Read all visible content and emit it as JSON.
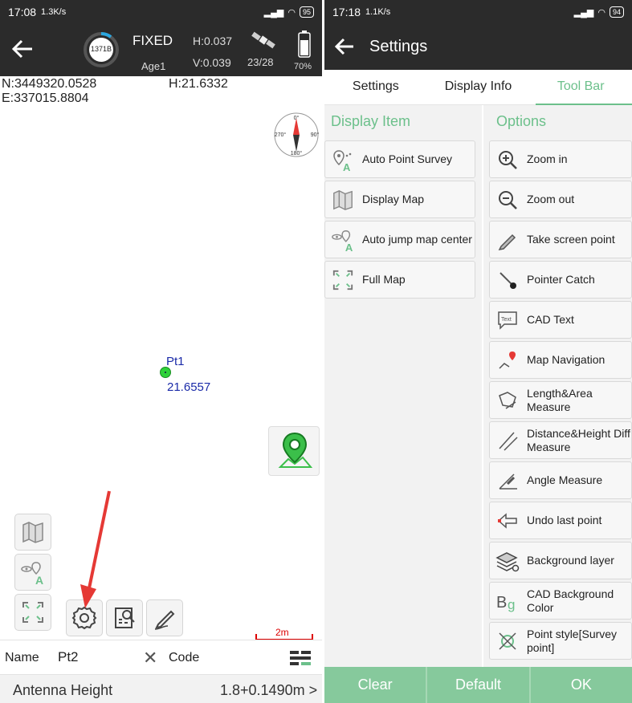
{
  "left_status": {
    "time": "17:08",
    "speed": "1.3K/s",
    "battery": "95"
  },
  "right_status": {
    "time": "17:18",
    "speed": "1.1K/s",
    "battery": "94"
  },
  "survey_header": {
    "station": "1371B",
    "solution": "FIXED",
    "age": "Age1",
    "h_precision": "H:0.037",
    "v_precision": "V:0.039",
    "satellites": "23/28",
    "battery_percent": "70%"
  },
  "coordinates": {
    "north": "N:3449320.0528",
    "height": "H:21.6332",
    "east": "E:337015.8804"
  },
  "compass": {
    "north": "0°",
    "east": "90°",
    "west": "270°",
    "south": "180°"
  },
  "map": {
    "point_name": "Pt1",
    "point_height": "21.6557",
    "scale": "2m"
  },
  "fields": {
    "name_label": "Name",
    "name_value": "Pt2",
    "code_label": "Code",
    "antenna_label": "Antenna Height",
    "antenna_value": "1.8+0.1490m >"
  },
  "settings": {
    "title": "Settings",
    "tabs": [
      {
        "label": "Settings"
      },
      {
        "label": "Display Info"
      },
      {
        "label": "Tool Bar"
      }
    ],
    "display_item_header": "Display Item",
    "options_header": "Options",
    "display_items": [
      {
        "label": "Auto Point Survey",
        "icon": "auto-point-survey-icon"
      },
      {
        "label": "Display Map",
        "icon": "map-icon"
      },
      {
        "label": "Auto jump map center",
        "icon": "auto-jump-icon"
      },
      {
        "label": "Full Map",
        "icon": "full-map-icon"
      }
    ],
    "options": [
      {
        "label": "Zoom in",
        "icon": "zoom-in-icon"
      },
      {
        "label": "Zoom out",
        "icon": "zoom-out-icon"
      },
      {
        "label": "Take screen point",
        "icon": "pencil-icon"
      },
      {
        "label": "Pointer Catch",
        "icon": "pointer-icon"
      },
      {
        "label": "CAD Text",
        "icon": "cad-text-icon"
      },
      {
        "label": "Map Navigation",
        "icon": "navigation-icon"
      },
      {
        "label": "Length&Area Measure",
        "icon": "area-measure-icon"
      },
      {
        "label": "Distance&Height Diff Measure",
        "icon": "distance-measure-icon"
      },
      {
        "label": "Angle Measure",
        "icon": "angle-icon"
      },
      {
        "label": "Undo last point",
        "icon": "undo-icon"
      },
      {
        "label": "Background layer",
        "icon": "layers-icon"
      },
      {
        "label": "CAD Background Color",
        "icon": "bg-color-icon"
      },
      {
        "label": "Point style[Survey point]",
        "icon": "point-style-icon"
      }
    ],
    "buttons": {
      "clear": "Clear",
      "default": "Default",
      "ok": "OK"
    }
  },
  "colors": {
    "accent": "#6cc08b",
    "header": "#2b2b2b",
    "point": "#2fd13a",
    "annotation": "#e53935"
  }
}
